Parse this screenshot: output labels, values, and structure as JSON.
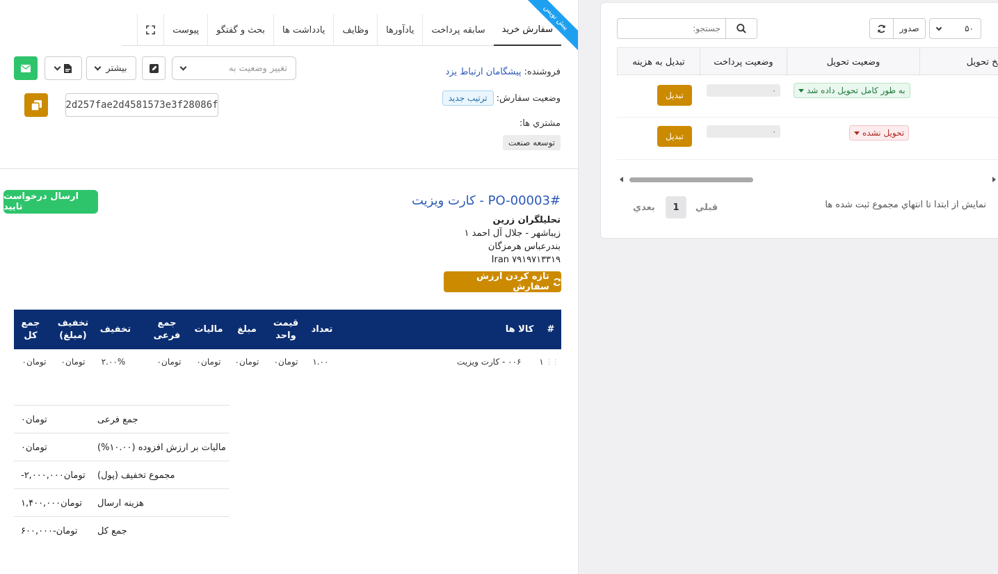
{
  "tabs": [
    {
      "label": "سفارش خرید"
    },
    {
      "label": "سابقه پرداخت"
    },
    {
      "label": "یادآورها"
    },
    {
      "label": "وظایف"
    },
    {
      "label": "یادداشت ها"
    },
    {
      "label": "بحث و گفتگو"
    },
    {
      "label": "پیوست"
    }
  ],
  "ribbon": "پیش نویس",
  "toolbar": {
    "status_select_placeholder": "تغییر وضعیت به",
    "more_label": "بیشتر"
  },
  "order_hash": "2d257fae2d4581573e3f28086f",
  "info": {
    "vendor_label": "فروشنده:",
    "vendor_value": "پیشگامان ارتباط یزد",
    "status_label": "وضعیت سفارش:",
    "status_value": "ترتیب جدید",
    "customers_label": "مشتري ها:",
    "customer_value": "توسعه صنعت"
  },
  "po": {
    "title": "#PO-00003 - کارت ویزیت",
    "address_lines": [
      "تحلیلگران زرین",
      "زیباشهر - جلال آل احمد ۱",
      "بندرعباس هرمزگان",
      "Iran ۷۹۱۹۷۱۳۳۱۹"
    ],
    "send_button": "ارسال درخواست تایید",
    "refresh_button": "تازه کردن ارزش سفارش"
  },
  "items_table": {
    "headers": [
      "#",
      "کالا ها",
      "تعداد",
      "قیمت واحد",
      "مبلغ",
      "مالیات",
      "جمع فرعی",
      "تخفیف",
      "تخفیف (مبلغ)",
      "جمع کل"
    ],
    "rows": [
      [
        "۱",
        "۰۰۶ - کارت ویزیت",
        "۱.۰۰",
        "تومان۰",
        "تومان۰",
        "تومان۰",
        "تومان۰",
        "۲.۰۰%",
        "تومان۰",
        "تومان۰"
      ]
    ]
  },
  "summary": [
    {
      "label": "جمع فرعی",
      "value": "تومان۰"
    },
    {
      "label": "مالیات بر ارزش افزوده (۱۰.۰۰%)",
      "value": "۰تومان"
    },
    {
      "label": "مجموع تخفیف (پول)",
      "value": "-تومان۲,۰۰۰,۰۰۰"
    },
    {
      "label": "هزینه ارسال",
      "value": "تومان۱,۴۰۰,۰۰۰"
    },
    {
      "label": "جمع کل",
      "value": "تومان-۶۰۰,۰۰۰"
    }
  ],
  "right": {
    "page_size": "۵۰",
    "export_label": "صدور",
    "search_placeholder": "جستجو:",
    "headers": [
      "تاریخ تحویل",
      "وضعیت تحویل",
      "وضعیت پرداخت",
      "تبدیل به هزینه"
    ],
    "rows": [
      {
        "delivery_status": "به طور کامل تحویل داده شد",
        "status_kind": "green",
        "payment": "۰",
        "convert": "تبدیل"
      },
      {
        "delivery_status": "تحویل نشده",
        "status_kind": "red",
        "payment": "۰",
        "convert": "تبدیل"
      }
    ],
    "pager_info": "نمایش از ابتدا تا انتهاي مجموع ثبت شده ها",
    "prev_label": "قبلي",
    "page_number": "1",
    "next_label": "بعدي"
  },
  "colors": {
    "accent_green": "#2ec46b",
    "accent_yellow": "#cc8a00",
    "table_header": "#0b2e72",
    "link": "#2a59b8",
    "ribbon": "#1ea0f0"
  }
}
